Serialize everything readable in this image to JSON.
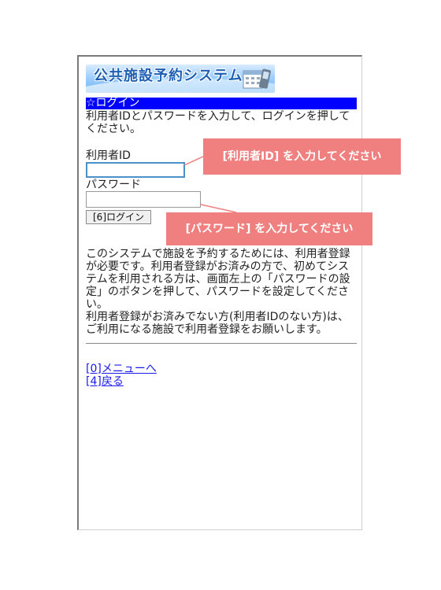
{
  "logo": {
    "title": "公共施設予約システム"
  },
  "page": {
    "title": "☆ログイン",
    "intro": "利用者IDとパスワードを入力して、ログインを押してください。"
  },
  "form": {
    "user_id_label": "利用者ID",
    "password_label": "パスワード",
    "login_button": "[6]ログイン"
  },
  "info": {
    "paragraph1": "このシステムで施設を予約するためには、利用者登録が必要です。利用者登録がお済みの方で、初めてシステムを利用される方は、画面左上の「パスワードの設定」のボタンを押して、パスワードを設定してください。",
    "paragraph2": "利用者登録がお済みでない方(利用者IDのない方)は、ご利用になる施設で利用者登録をお願いします。"
  },
  "links": {
    "menu": "[0]メニューへ",
    "back": "[4]戻る"
  },
  "callouts": {
    "user_id": "[利用者ID] を入力してください",
    "password": "[パスワード] を入力してください"
  },
  "colors": {
    "title_bar": "#0000ff",
    "callout": "#f08080",
    "link": "#1a1aee"
  }
}
